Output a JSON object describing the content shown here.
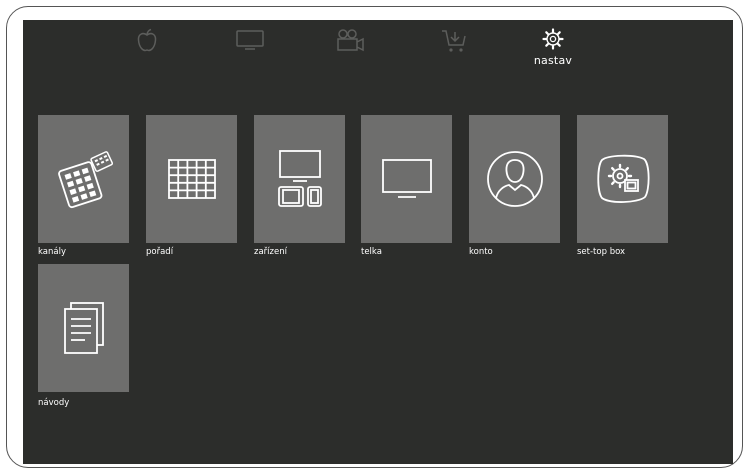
{
  "colors": {
    "screen_bg": "#2c2d2b",
    "tile_bg": "#6e6e6d",
    "icon_active": "#ffffff",
    "icon_inactive": "#5d5e5c"
  },
  "topnav": {
    "items": [
      {
        "icon": "apple-icon",
        "label": ""
      },
      {
        "icon": "tv-icon",
        "label": ""
      },
      {
        "icon": "video-camera-icon",
        "label": ""
      },
      {
        "icon": "cart-icon",
        "label": ""
      },
      {
        "icon": "gear-icon",
        "label": "nastav",
        "active": true
      }
    ]
  },
  "tiles": [
    {
      "icon": "keypad-icon",
      "label": "kanály"
    },
    {
      "icon": "grid-icon",
      "label": "pořadí"
    },
    {
      "icon": "devices-icon",
      "label": "zařízení"
    },
    {
      "icon": "tv-icon",
      "label": "telka"
    },
    {
      "icon": "user-icon",
      "label": "konto"
    },
    {
      "icon": "settings-box-icon",
      "label": "set-top box"
    },
    {
      "icon": "document-icon",
      "label": "návody"
    }
  ]
}
